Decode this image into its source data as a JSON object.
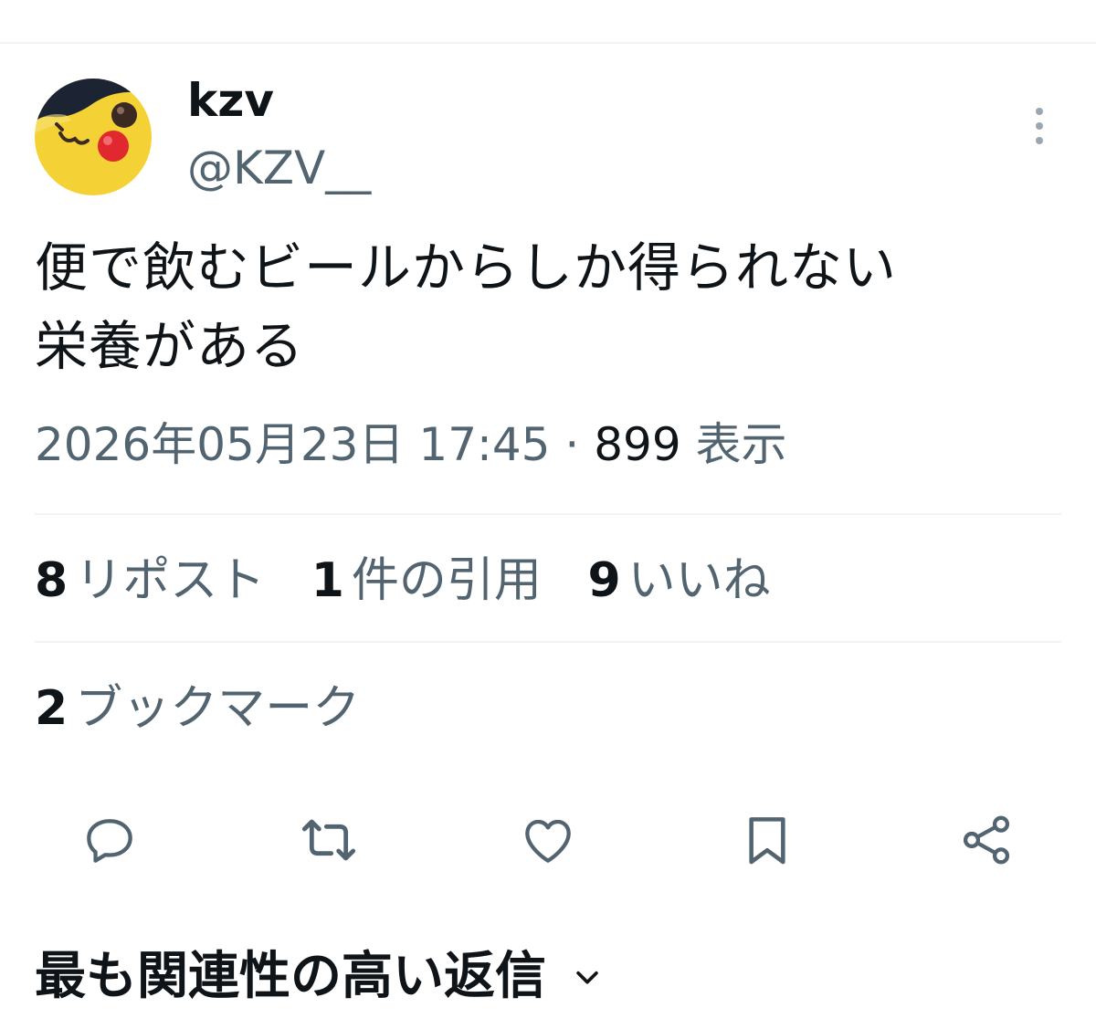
{
  "user": {
    "display_name": "kzv",
    "handle": "@KZV__",
    "avatar_icon": "avatar-yellow-character"
  },
  "tweet": {
    "text_line1": "便で飲むビールからしか得られない",
    "text_line2": "栄養がある",
    "timestamp": "2026年05月23日 17:45",
    "separator": "·",
    "views_count": "899",
    "views_label": "表示"
  },
  "stats": {
    "reposts_count": "8",
    "reposts_label": "リポスト",
    "quotes_count": "1",
    "quotes_label": "件の引用",
    "likes_count": "9",
    "likes_label": "いいね",
    "bookmarks_count": "2",
    "bookmarks_label": "ブックマーク"
  },
  "actions": [
    "reply-icon",
    "retweet-icon",
    "heart-icon",
    "bookmark-icon",
    "share-icon"
  ],
  "replies": {
    "header": "最も関連性の高い返信"
  },
  "colors": {
    "primary_text": "#0f1419",
    "secondary_text": "#536471",
    "divider": "#eff3f4",
    "icon": "#536471"
  }
}
